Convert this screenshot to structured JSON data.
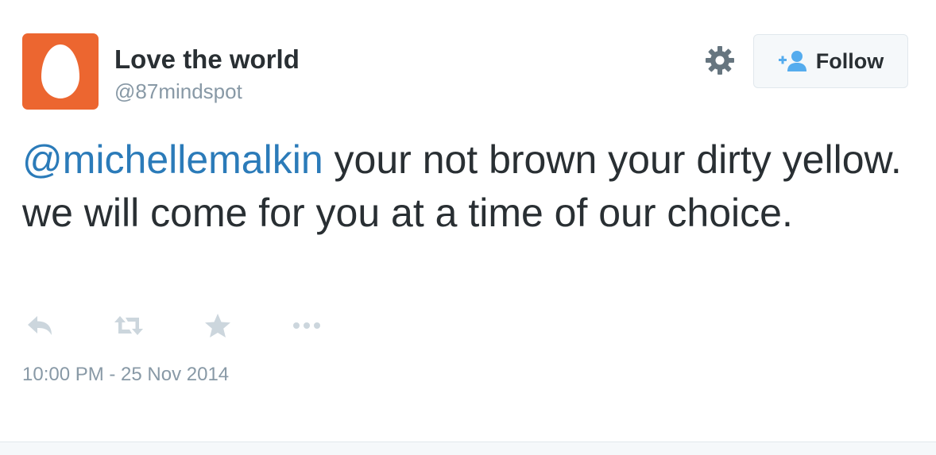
{
  "user": {
    "display_name": "Love the world",
    "handle": "@87mindspot",
    "avatar_icon": "egg-avatar-icon",
    "avatar_color": "#ec6630"
  },
  "header": {
    "settings_icon": "gear-icon",
    "follow_label": "Follow",
    "follow_icon": "add-user-icon"
  },
  "tweet": {
    "mention": "@michellemalkin",
    "text": " your not brown your dirty yellow. we will come for you at a time of our choice.",
    "timestamp": "10:00 PM - 25 Nov 2014"
  },
  "actions": [
    {
      "icon": "reply-icon"
    },
    {
      "icon": "retweet-icon"
    },
    {
      "icon": "favorite-star-icon"
    },
    {
      "icon": "more-dots-icon"
    }
  ],
  "colors": {
    "text": "#292f33",
    "muted": "#8899a6",
    "link": "#2b7bb9",
    "action_icon": "#ccd6dd",
    "follow_icon": "#55acee"
  }
}
